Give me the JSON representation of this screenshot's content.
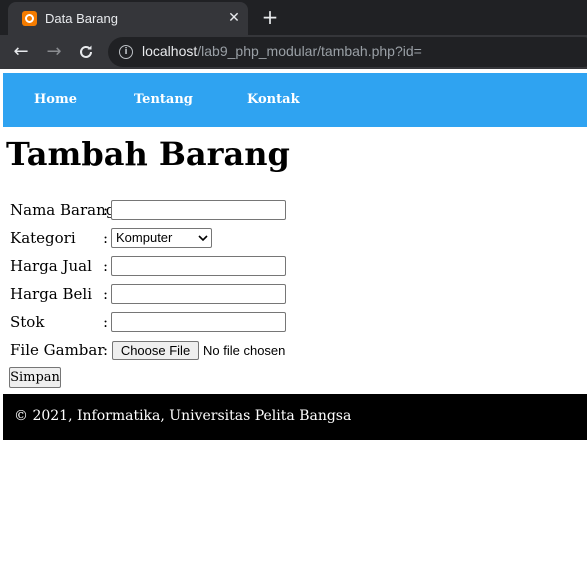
{
  "browser": {
    "tab_title": "Data Barang",
    "url_host": "localhost",
    "url_path": "/lab9_php_modular/tambah.php?id="
  },
  "menu": {
    "items": [
      {
        "label": "Home"
      },
      {
        "label": "Tentang"
      },
      {
        "label": "Kontak"
      }
    ]
  },
  "page": {
    "title": "Tambah Barang"
  },
  "form": {
    "fields": [
      {
        "label": "Nama Barang",
        "value": ""
      },
      {
        "label": "Kategori",
        "value": "Komputer"
      },
      {
        "label": "Harga Jual",
        "value": ""
      },
      {
        "label": "Harga Beli",
        "value": ""
      },
      {
        "label": "Stok",
        "value": ""
      },
      {
        "label": "File Gambar"
      }
    ],
    "colon": ":",
    "file_button": "Choose File",
    "file_status": "No file chosen",
    "submit_label": "Simpan"
  },
  "footer": {
    "text": "© 2021, Informatika, Universitas Pelita Bangsa"
  },
  "colors": {
    "menu_bg": "#2fa3f1",
    "footer_bg": "#000000",
    "browser_bg": "#35363a"
  }
}
